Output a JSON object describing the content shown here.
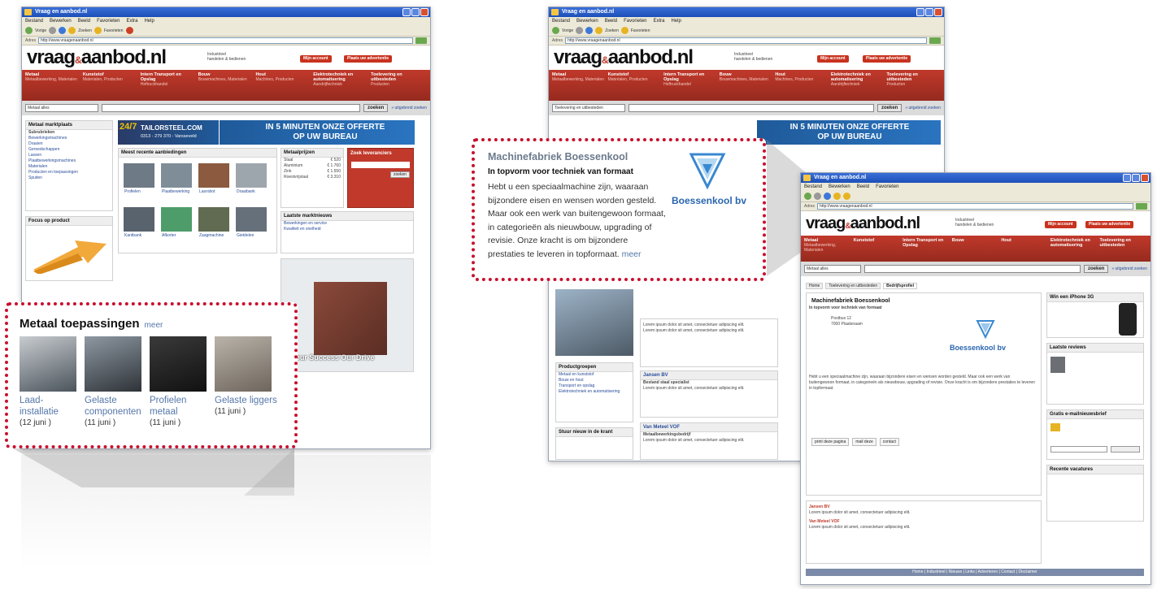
{
  "browser": {
    "title": "Vraag en aanbod.nl",
    "menu": [
      "Bestand",
      "Bewerken",
      "Beeld",
      "Favorieten",
      "Extra",
      "Help"
    ],
    "toolbar": [
      "Vorige",
      "Zoeken",
      "Favorieten"
    ],
    "address_label": "Adres",
    "url": "http://www.vraagenaanbod.nl"
  },
  "site": {
    "logo_a": "vraag",
    "logo_sep": "&",
    "logo_b": "aanbod",
    "logo_tld": ".nl",
    "slogan_1": "Industrieel",
    "slogan_2": "handelen & bedienen",
    "btn_login": "Mijn account",
    "btn_place": "Plaats uw advertentie",
    "nav": [
      {
        "title": "Metaal",
        "sub": "Metaalbewerking, Materialen"
      },
      {
        "title": "Kunststof",
        "sub": "Materialen, Producten"
      },
      {
        "title": "Intern Transport en Opslag",
        "sub": "Heftruckhandel"
      },
      {
        "title": "Bouw",
        "sub": "Bouwmachines, Materialen"
      },
      {
        "title": "Hout",
        "sub": "Machines, Producten"
      },
      {
        "title": "Elektrotechniek en automatisering",
        "sub": "Aandrijftechniek"
      },
      {
        "title": "Toelevering en uitbesteden",
        "sub": "Producten"
      }
    ],
    "search_select_1": "Metaal alles",
    "search_select_2": "Toelevering en uitbesteden",
    "search_button": "zoeken",
    "search_link": "» uitgebreid zoeken",
    "banner_left": "TAILORSTEEL.COM",
    "banner_left_sub": "0313 - 279 370 - Varsseveld",
    "banner_right_1": "IN 5 MINUTEN ONZE OFFERTE",
    "banner_right_2": "OP UW BUREAU"
  },
  "left_window": {
    "market_title": "Metaal marktplaats",
    "sub_title": "Subrubrieken",
    "sub_items": [
      "Bewerkingsmachines",
      "Draaien",
      "Gereedschappen",
      "Lassen",
      "Plaatbewerkingsmachines",
      "Materialen",
      "Producten en toepassingen",
      "Spuiten"
    ],
    "focus_title": "Focus op product",
    "recent_title": "Meest recente aanbiedingen",
    "recent_items": [
      "Profielen",
      "Plaatbewerking",
      "Lasrobot",
      "Draaibank",
      "Kantbank",
      "Afkorter",
      "Zaagmachine",
      "Gietdelen"
    ],
    "price_title": "Metaalprijzen",
    "prices": [
      {
        "name": "Staal",
        "value": "€ 520"
      },
      {
        "name": "Aluminium",
        "value": "€ 1.760"
      },
      {
        "name": "Zink",
        "value": "€ 1.550"
      },
      {
        "name": "Roestvrijstaal",
        "value": "€ 3.310"
      }
    ],
    "news_title": "Laatste marktnieuws",
    "search_box_title": "Zoek leveranciers",
    "sponsor_text": "Your Success Our Drive",
    "sponsor_items": [
      "Bewerkingen en service",
      "Kwaliteit en snelheid"
    ]
  },
  "callout_left": {
    "title": "Metaal toepassingen",
    "more": "meer",
    "items": [
      {
        "label_1": "Laad-",
        "label_2": "installatie",
        "date": "(12 juni )"
      },
      {
        "label_1": "Gelaste",
        "label_2": "componenten",
        "date": "(11 juni )"
      },
      {
        "label_1": "Profielen",
        "label_2": "metaal",
        "date": "(11 juni )"
      },
      {
        "label_1": "Gelaste liggers",
        "label_2": "",
        "date": "(11 juni )"
      }
    ]
  },
  "callout_right": {
    "title": "Machinefabriek Boessenkool",
    "subtitle": "In topvorm voor techniek van formaat",
    "body": "Hebt u een speciaalmachine zijn, waaraan bijzondere eisen en wensen worden gesteld. Maar ook een werk van buitengewoon formaat, in categorieën als nieuwbouw, upgrading of revisie. Onze kracht is om bijzondere prestaties te leveren in topformaat.",
    "more": "meer",
    "logo_name": "Boessenkool bv"
  },
  "middle_window": {
    "side_title": "Productgroepen",
    "side_items": [
      "Metaal en kunststof",
      "Bouw en hout",
      "Transport en opslag",
      "Elektrotechniek en automatisering"
    ],
    "news_title": "Stuur nieuw in de krant",
    "company_1": "Jansen BV",
    "company_1_sub": "Bestand staal specialist",
    "company_2": "Van Meteel VOF",
    "company_2_sub": "Metaalbewerkingsbedrijf",
    "lorem": "Lorem ipsum dolor sit amet, consectetuer adipiscing elit."
  },
  "detail_window": {
    "breadcrumb": [
      "Home",
      "Toelevering en uitbesteden",
      "Bedrijfsprofiel"
    ],
    "company": "Machinefabriek Boessenkool",
    "tagline": "In topvorm voor techniek van formaat",
    "address": "Postbus 12",
    "city": "7000 Plaatsnaam",
    "buttons": [
      "print deze pagina",
      "mail deze",
      "contact"
    ],
    "iphone_title": "Win een iPhone 3G",
    "reviews_title": "Laatste reviews",
    "newsletter_title": "Gratis e-mailnieuwsbrief",
    "recent_title": "Recente vacatures",
    "footer": "Home | Industrieel | Nieuws | Links | Adverteren | Contact | Disclaimer"
  }
}
